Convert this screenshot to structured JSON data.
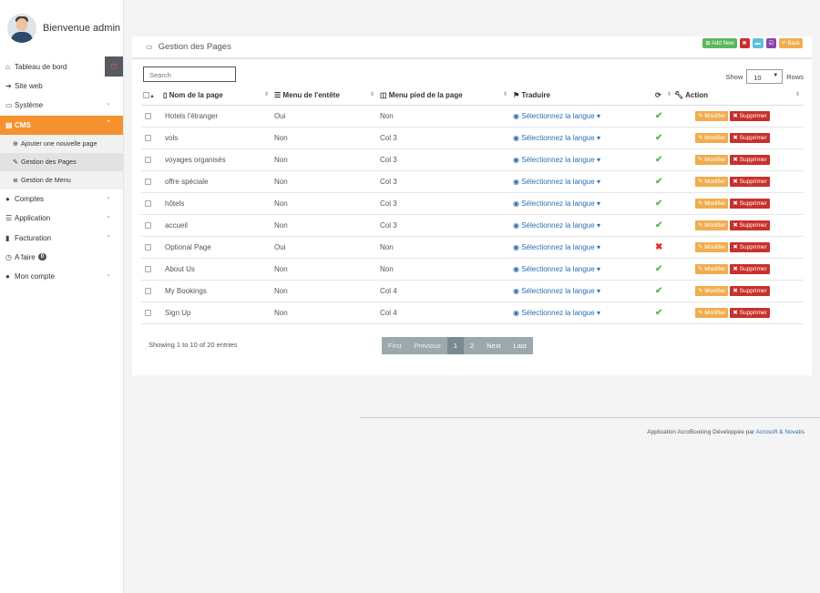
{
  "user": {
    "greeting": "Bienvenue admin"
  },
  "sidebar": {
    "items": [
      {
        "label": "Tableau de bord",
        "icon": "home-icon"
      },
      {
        "label": "Site web",
        "icon": "sign-in-icon"
      },
      {
        "label": "Système",
        "icon": "laptop-icon"
      },
      {
        "label": "CMS",
        "icon": "cms-icon"
      },
      {
        "label": "Comptes",
        "icon": "user-icon"
      },
      {
        "label": "Application",
        "icon": "list-icon"
      },
      {
        "label": "Facturation",
        "icon": "file-icon"
      },
      {
        "label": "A faire",
        "icon": "clock-icon",
        "badge": "0"
      },
      {
        "label": "Mon compte",
        "icon": "user-icon"
      }
    ],
    "cms_sub": [
      {
        "label": "Ajouter une nouvelle page"
      },
      {
        "label": "Gestion des Pages"
      },
      {
        "label": "Gestion de Menu"
      }
    ]
  },
  "panel": {
    "title": "Gestion des Pages",
    "add_label": "Add New",
    "back_label": "Back",
    "search_placeholder": "Search",
    "show_label": "Show",
    "rows_label": "Rows",
    "show_value": "10",
    "columns": [
      "Nom de la page",
      "Menu de l'entête",
      "Menu pied de la page",
      "Traduire",
      "Action"
    ],
    "lang_label": "Sélectionnez la langue",
    "edit_label": "Modifier",
    "delete_label": "Supprimer",
    "rows": [
      {
        "name": "Hotels l'étranger",
        "header": "Oui",
        "footer": "Non",
        "status": true
      },
      {
        "name": "vols",
        "header": "Non",
        "footer": "Col 3",
        "status": true
      },
      {
        "name": "voyages organisés",
        "header": "Non",
        "footer": "Col 3",
        "status": true
      },
      {
        "name": "offre spéciale",
        "header": "Non",
        "footer": "Col 3",
        "status": true
      },
      {
        "name": "hôtels",
        "header": "Non",
        "footer": "Col 3",
        "status": true
      },
      {
        "name": "accueil",
        "header": "Non",
        "footer": "Col 3",
        "status": true
      },
      {
        "name": "Optional Page",
        "header": "Oui",
        "footer": "Non",
        "status": false
      },
      {
        "name": "About Us",
        "header": "Non",
        "footer": "Non",
        "status": true
      },
      {
        "name": "My Bookings",
        "header": "Non",
        "footer": "Col 4",
        "status": true
      },
      {
        "name": "Sign Up",
        "header": "Non",
        "footer": "Col 4",
        "status": true
      }
    ],
    "info": "Showing 1 to 10 of 20 entries",
    "pagination": [
      "First",
      "Previous",
      "1",
      "2",
      "Next",
      "Last"
    ]
  },
  "footer": {
    "prefix": "Application AcroBooking Développée par",
    "link1": "Acrosoft",
    "amp": "&",
    "link2": "Novatis"
  },
  "colors": {
    "accent": "#f5922f",
    "success": "#5cb85c",
    "danger": "#c9302c",
    "warning": "#f0ad4e"
  }
}
